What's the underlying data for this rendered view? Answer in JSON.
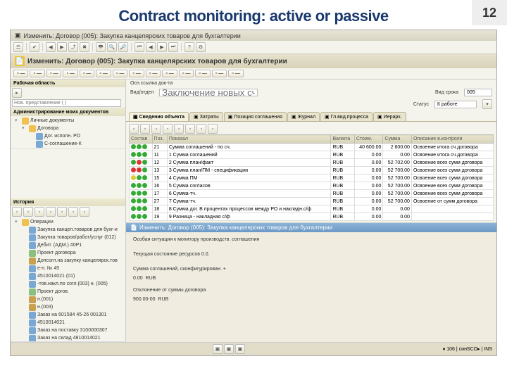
{
  "slide": {
    "title": "Contract monitoring: active or passive",
    "page": "12"
  },
  "window": {
    "title": "Изменить: Договор (005): Закупка канцелярских товаров для бухгалтерии",
    "header": "Изменить: Договор (005): Закупка канцелярских товаров для бухгалтерии"
  },
  "toolbar2": [
    "",
    "",
    "",
    "",
    "",
    "",
    "",
    "",
    "",
    ""
  ],
  "sidebar": {
    "workarea_label": "Рабочая область",
    "search_placeholder": "Нов. представление ( )",
    "sec1_title": "Администрирование моих документов",
    "tree1": [
      {
        "l": 1,
        "t": "▾",
        "ic": "ic-folder",
        "txt": "Личные документы"
      },
      {
        "l": 2,
        "t": "▾",
        "ic": "ic-folder",
        "txt": "Договора"
      },
      {
        "l": 3,
        "t": " ",
        "ic": "ic-doc",
        "txt": "Дог. исполн. РО"
      },
      {
        "l": 3,
        "t": " ",
        "ic": "ic-doc",
        "txt": "С-соглашение-К"
      }
    ],
    "sec2_title": "История",
    "sec3_toolbar": [
      "",
      "",
      "",
      "",
      "",
      "",
      ""
    ],
    "tree2": [
      {
        "l": 1,
        "t": "▾",
        "ic": "ic-folder",
        "txt": "Операции"
      },
      {
        "l": 2,
        "t": " ",
        "ic": "ic-doc",
        "txt": "Закупка канцел.товаров для бухг-и"
      },
      {
        "l": 2,
        "t": " ",
        "ic": "ic-doc",
        "txt": "Закупка товаров/работ/услуг (012)"
      },
      {
        "l": 2,
        "t": " ",
        "ic": "ic-doc",
        "txt": "Дебит. (АДМ.) #0P1"
      },
      {
        "l": 2,
        "t": " ",
        "ic": "ic-doc2",
        "txt": "Проект договора"
      },
      {
        "l": 2,
        "t": " ",
        "ic": "ic-gear",
        "txt": "Допсогл.на закупку канцелярск.тов"
      },
      {
        "l": 2,
        "t": " ",
        "ic": "ic-doc",
        "txt": "е-п. № 45"
      },
      {
        "l": 2,
        "t": " ",
        "ic": "ic-doc",
        "txt": "4510014021 (01)"
      },
      {
        "l": 2,
        "t": " ",
        "ic": "ic-doc",
        "txt": "-тов.накл.по согл.(003) н. (005)"
      },
      {
        "l": 2,
        "t": " ",
        "ic": "ic-doc2",
        "txt": "Проект догов."
      },
      {
        "l": 2,
        "t": " ",
        "ic": "ic-gear",
        "txt": "н.(001)"
      },
      {
        "l": 2,
        "t": " ",
        "ic": "ic-gear",
        "txt": "н.(003)"
      },
      {
        "l": 2,
        "t": " ",
        "ic": "ic-doc",
        "txt": "Заказ на 601584 45-26 001301"
      },
      {
        "l": 2,
        "t": " ",
        "ic": "ic-doc",
        "txt": "4510014021"
      },
      {
        "l": 2,
        "t": " ",
        "ic": "ic-doc",
        "txt": "Заказ на поставку 3100000307"
      },
      {
        "l": 2,
        "t": " ",
        "ic": "ic-doc",
        "txt": "Заказ на склад 4810014021"
      }
    ]
  },
  "content": {
    "form": {
      "osn_label": "Осн.ссылка док-та",
      "srok_label": "Вид/отдел",
      "input_placeholder": "Заключение новых сч.",
      "vid_label": "Вид срока",
      "vid_val": "005",
      "stat_label": "Статус",
      "stat_val": "К работе"
    },
    "tabs": [
      {
        "label": "Сведения объекта",
        "active": true
      },
      {
        "label": "Затраты"
      },
      {
        "label": "Позиция соглашения"
      },
      {
        "label": "Журнал"
      },
      {
        "label": "Гл.вид.процесса"
      },
      {
        "label": "Иерарх."
      }
    ],
    "grid": {
      "cols": [
        "Состав",
        "Поз.",
        "Показал",
        "Валюта",
        "Стоим.",
        "Сумма",
        "Описание в.контроля"
      ],
      "rows": [
        {
          "s": [
            "g",
            "g",
            "g"
          ],
          "pos": "21",
          "txt": "Сумма соглашений - по сч.",
          "cur": "RUB",
          "a": "40 600.00",
          "b": "2 600.00",
          "d": "Освоение итога сч.договора"
        },
        {
          "s": [
            "g",
            "g",
            "g"
          ],
          "pos": "11",
          "txt": "1 Сумма соглашений",
          "cur": "RUB",
          "a": "0.00",
          "b": "0.00",
          "d": "Освоение итога сч.договора"
        },
        {
          "s": [
            "g",
            "r",
            "g"
          ],
          "pos": "12",
          "txt": "2 Сумма план/факт",
          "cur": "RUB",
          "a": "0.00",
          "b": "52 702.00",
          "d": "Освоение всех сумм договора"
        },
        {
          "s": [
            "r",
            "r",
            "g"
          ],
          "pos": "13",
          "txt": "3 Сумма план/ПМ - спецификации",
          "cur": "RUB",
          "a": "0.00",
          "b": "52 700.00",
          "d": "Освоение всех сумм договора"
        },
        {
          "s": [
            "y",
            "g",
            "g"
          ],
          "pos": "15",
          "txt": "4 Сумма ПМ",
          "cur": "RUB",
          "a": "0.00",
          "b": "52 700.00",
          "d": "Освоение всех сумм договора"
        },
        {
          "s": [
            "g",
            "g",
            "g"
          ],
          "pos": "16",
          "txt": "5 Сумма согласов",
          "cur": "RUB",
          "a": "0.00",
          "b": "52 700.00",
          "d": "Освоение всех сумм договора"
        },
        {
          "s": [
            "g",
            "g",
            "g"
          ],
          "pos": "17",
          "txt": "6 Сумма-тч.",
          "cur": "RUB",
          "a": "0.00",
          "b": "52 700.00",
          "d": "Освоение всех сумм договора"
        },
        {
          "s": [
            "g",
            "g",
            "g"
          ],
          "pos": "27",
          "txt": "7 Сумма-тч.",
          "cur": "RUB",
          "a": "0.00",
          "b": "52 700.00",
          "d": "Освоение от сумм договора"
        },
        {
          "s": [
            "g",
            "g",
            "g"
          ],
          "pos": "18",
          "txt": "8 Сумма дог. В процентах процессов между РО и накладн.с/ф",
          "cur": "RUB",
          "a": "0.00",
          "b": "0.00",
          "d": ""
        },
        {
          "s": [
            "g",
            "g",
            "g"
          ],
          "pos": "19",
          "txt": "9 Разница - накладная с/ф",
          "cur": "RUB",
          "a": "0.00",
          "b": "0.00",
          "d": ""
        }
      ]
    },
    "detail": {
      "title": "Изменить: Договор (005): Закупка канцелярских товаров для бухгалтерии",
      "line1": "Особая ситуация к монитору производств. соглашения",
      "line2": "Текущая состояние ресурсов 0.0.",
      "line3_lbl": "Сумма соглашений, сконфигурирован. +",
      "line3_a": "0.00",
      "line3_b": "RUB",
      "line4_lbl": "Отклонение от суммы договора",
      "line4_a": "900.00-00",
      "line4_b": "RUB"
    }
  },
  "status": {
    "right": "♦ 106  |  cинSCO▸  |  INS"
  }
}
